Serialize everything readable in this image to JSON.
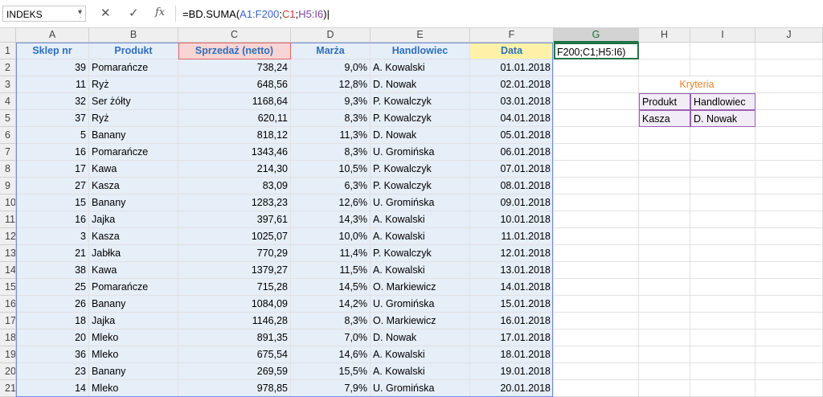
{
  "formula_bar": {
    "name_box": "INDEKS",
    "cancel_icon": "✕",
    "enter_icon": "✓",
    "fx_label": "fx",
    "formula_parts": [
      {
        "text": "=BD.SUMA(",
        "color": "#000000"
      },
      {
        "text": "A1:F200",
        "color": "#3b64c7"
      },
      {
        "text": ";",
        "color": "#000000"
      },
      {
        "text": "C1",
        "color": "#c0392b"
      },
      {
        "text": ";",
        "color": "#000000"
      },
      {
        "text": "H5:I6",
        "color": "#7b3fa0"
      },
      {
        "text": ")",
        "color": "#000000"
      }
    ]
  },
  "columns": [
    "A",
    "B",
    "C",
    "D",
    "E",
    "F",
    "G",
    "H",
    "I",
    "J"
  ],
  "selected_column": "G",
  "headers": {
    "A": "Sklep nr",
    "B": "Produkt",
    "C": "Sprzedaż (netto)",
    "D": "Marża",
    "E": "Handlowiec",
    "F": "Data"
  },
  "editing_cell": {
    "ref": "G1",
    "text": "F200;C1;H5:I6)"
  },
  "criteria": {
    "title": "Kryteria",
    "header": [
      "Produkt",
      "Handlowiec"
    ],
    "row": [
      "Kasza",
      "D. Nowak"
    ]
  },
  "rows": [
    {
      "n": 2,
      "a": "39",
      "b": "Pomarańcze",
      "c": "738,24",
      "d": "9,0%",
      "e": "A. Kowalski",
      "f": "01.01.2018"
    },
    {
      "n": 3,
      "a": "11",
      "b": "Ryż",
      "c": "648,56",
      "d": "12,8%",
      "e": "D. Nowak",
      "f": "02.01.2018"
    },
    {
      "n": 4,
      "a": "32",
      "b": "Ser żółty",
      "c": "1168,64",
      "d": "9,3%",
      "e": "P. Kowalczyk",
      "f": "03.01.2018"
    },
    {
      "n": 5,
      "a": "37",
      "b": "Ryż",
      "c": "620,11",
      "d": "8,3%",
      "e": "P. Kowalczyk",
      "f": "04.01.2018"
    },
    {
      "n": 6,
      "a": "5",
      "b": "Banany",
      "c": "818,12",
      "d": "11,3%",
      "e": "D. Nowak",
      "f": "05.01.2018"
    },
    {
      "n": 7,
      "a": "16",
      "b": "Pomarańcze",
      "c": "1343,46",
      "d": "8,3%",
      "e": "U. Gromińska",
      "f": "06.01.2018"
    },
    {
      "n": 8,
      "a": "17",
      "b": "Kawa",
      "c": "214,30",
      "d": "10,5%",
      "e": "P. Kowalczyk",
      "f": "07.01.2018"
    },
    {
      "n": 9,
      "a": "27",
      "b": "Kasza",
      "c": "83,09",
      "d": "6,3%",
      "e": "P. Kowalczyk",
      "f": "08.01.2018"
    },
    {
      "n": 10,
      "a": "15",
      "b": "Banany",
      "c": "1283,23",
      "d": "12,6%",
      "e": "U. Gromińska",
      "f": "09.01.2018"
    },
    {
      "n": 11,
      "a": "16",
      "b": "Jajka",
      "c": "397,61",
      "d": "14,3%",
      "e": "A. Kowalski",
      "f": "10.01.2018"
    },
    {
      "n": 12,
      "a": "3",
      "b": "Kasza",
      "c": "1025,07",
      "d": "10,0%",
      "e": "A. Kowalski",
      "f": "11.01.2018"
    },
    {
      "n": 13,
      "a": "21",
      "b": "Jabłka",
      "c": "770,29",
      "d": "11,4%",
      "e": "P. Kowalczyk",
      "f": "12.01.2018"
    },
    {
      "n": 14,
      "a": "38",
      "b": "Kawa",
      "c": "1379,27",
      "d": "11,5%",
      "e": "A. Kowalski",
      "f": "13.01.2018"
    },
    {
      "n": 15,
      "a": "25",
      "b": "Pomarańcze",
      "c": "715,28",
      "d": "14,5%",
      "e": "O. Markiewicz",
      "f": "14.01.2018"
    },
    {
      "n": 16,
      "a": "26",
      "b": "Banany",
      "c": "1084,09",
      "d": "14,2%",
      "e": "U. Gromińska",
      "f": "15.01.2018"
    },
    {
      "n": 17,
      "a": "18",
      "b": "Jajka",
      "c": "1146,28",
      "d": "8,3%",
      "e": "O. Markiewicz",
      "f": "16.01.2018"
    },
    {
      "n": 18,
      "a": "20",
      "b": "Mleko",
      "c": "891,35",
      "d": "7,0%",
      "e": "D. Nowak",
      "f": "17.01.2018"
    },
    {
      "n": 19,
      "a": "36",
      "b": "Mleko",
      "c": "675,54",
      "d": "14,6%",
      "e": "A. Kowalski",
      "f": "18.01.2018"
    },
    {
      "n": 20,
      "a": "23",
      "b": "Banany",
      "c": "269,59",
      "d": "15,5%",
      "e": "A. Kowalski",
      "f": "19.01.2018"
    },
    {
      "n": 21,
      "a": "14",
      "b": "Mleko",
      "c": "978,85",
      "d": "7,9%",
      "e": "U. Gromińska",
      "f": "20.01.2018"
    }
  ]
}
